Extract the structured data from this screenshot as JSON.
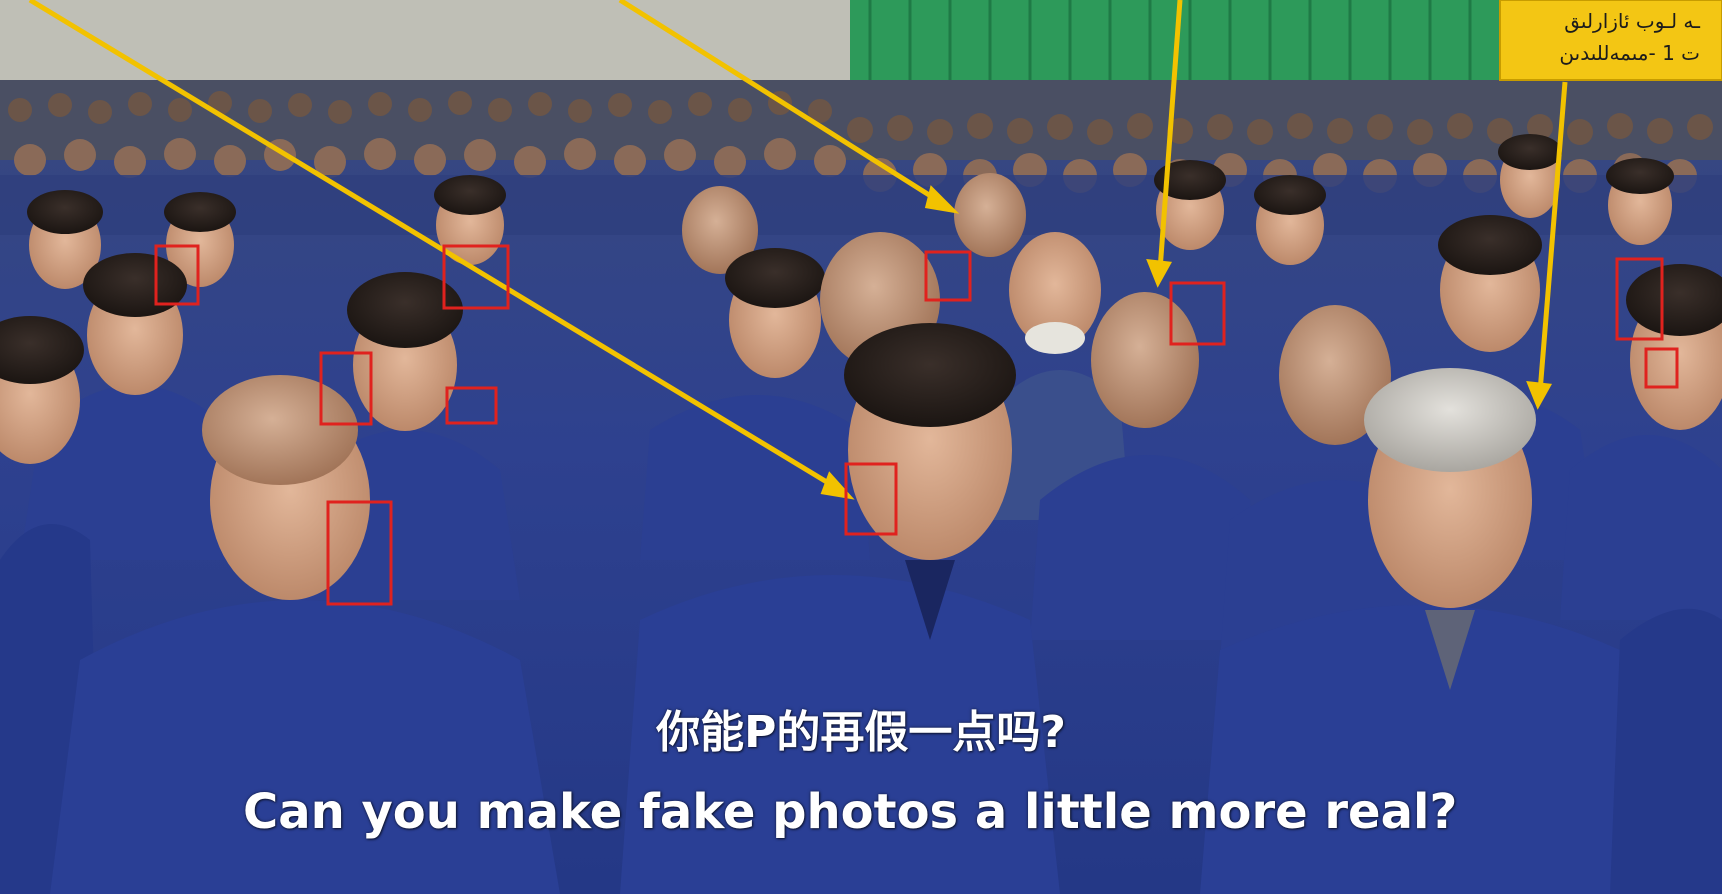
{
  "meme": {
    "caption_zh": "你能P的再假一点吗?",
    "caption_en": "Can you make fake photos a little more real?"
  },
  "sign": {
    "line1": "ـه لـوب ئازارلىق",
    "line2": "ت 1 -مىمەللىدىن"
  },
  "colors": {
    "highlight_box": "#e0221e",
    "arrow": "#f2c200",
    "uniform": "#2a3f95",
    "sign_bg": "#f3c614"
  }
}
